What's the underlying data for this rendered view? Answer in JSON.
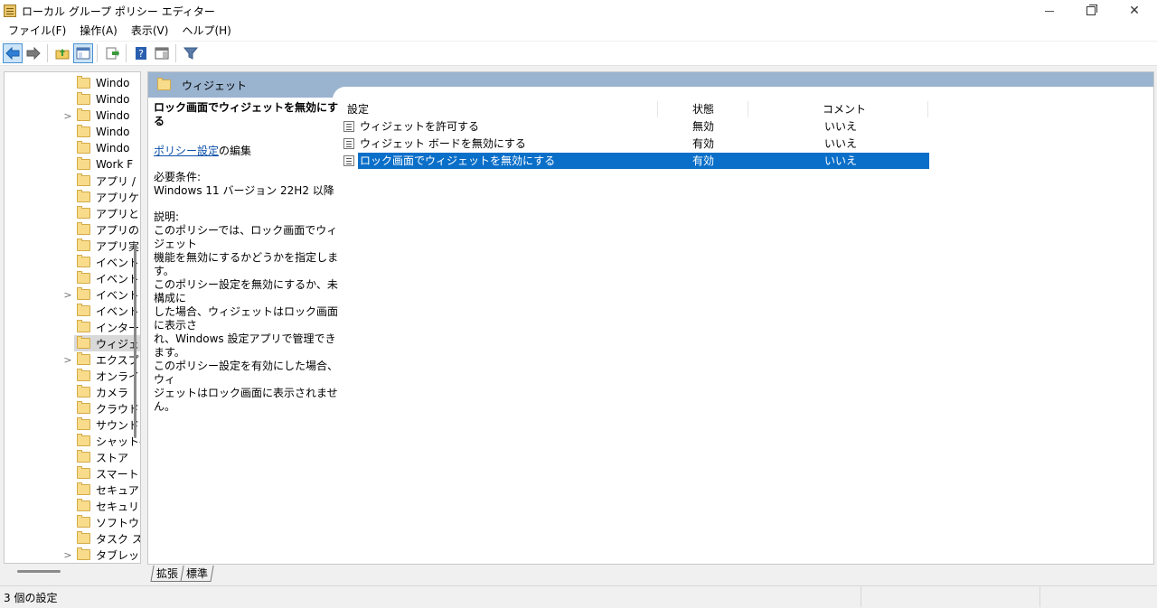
{
  "window": {
    "title": "ローカル グループ ポリシー エディター"
  },
  "menu": [
    "ファイル(F)",
    "操作(A)",
    "表示(V)",
    "ヘルプ(H)"
  ],
  "tree": {
    "items": [
      {
        "label": "Windo",
        "chev": ""
      },
      {
        "label": "Windo",
        "chev": ""
      },
      {
        "label": "Windo",
        "chev": ">"
      },
      {
        "label": "Windo",
        "chev": ""
      },
      {
        "label": "Windo",
        "chev": ""
      },
      {
        "label": "Work F",
        "chev": ""
      },
      {
        "label": "アプリ /",
        "chev": ""
      },
      {
        "label": "アプリケ",
        "chev": ""
      },
      {
        "label": "アプリと",
        "chev": ""
      },
      {
        "label": "アプリの",
        "chev": ""
      },
      {
        "label": "アプリ実",
        "chev": ""
      },
      {
        "label": "イベント",
        "chev": ""
      },
      {
        "label": "イベント",
        "chev": ""
      },
      {
        "label": "イベント",
        "chev": ">"
      },
      {
        "label": "イベント",
        "chev": ""
      },
      {
        "label": "インターこ",
        "chev": ""
      },
      {
        "label": "ウィジェッ",
        "chev": "",
        "selected": true
      },
      {
        "label": "エクスプ",
        "chev": ">"
      },
      {
        "label": "オンライ",
        "chev": ""
      },
      {
        "label": "カメラ",
        "chev": ""
      },
      {
        "label": "クラウド",
        "chev": ""
      },
      {
        "label": "サウンド",
        "chev": ""
      },
      {
        "label": "シャット-",
        "chev": ""
      },
      {
        "label": "ストア",
        "chev": ""
      },
      {
        "label": "スマート",
        "chev": ""
      },
      {
        "label": "セキュア",
        "chev": ""
      },
      {
        "label": "セキュリ",
        "chev": ""
      },
      {
        "label": "ソフトウ:",
        "chev": ""
      },
      {
        "label": "タスク ス",
        "chev": ""
      },
      {
        "label": "タブレッ",
        "chev": ">"
      }
    ]
  },
  "panel": {
    "header": "ウィジェット",
    "description": {
      "title": "ロック画面でウィジェットを無効にする",
      "edit_link": "ポリシー設定",
      "edit_suffix": "の編集",
      "req_label": "必要条件:",
      "req_value": "Windows 11 バージョン 22H2 以降",
      "desc_label": "説明:",
      "desc_lines": [
        "このポリシーでは、ロック画面でウィジェット",
        "機能を無効にするかどうかを指定します。",
        "このポリシー設定を無効にするか、未構成に",
        "した場合、ウィジェットはロック画面に表示さ",
        "れ、Windows 設定アプリで管理できます。",
        "このポリシー設定を有効にした場合、ウィ",
        "ジェットはロック画面に表示されません。"
      ]
    },
    "columns": {
      "setting": "設定",
      "state": "状態",
      "comment": "コメント"
    },
    "rows": [
      {
        "name": "ウィジェットを許可する",
        "state": "無効",
        "comment": "いいえ"
      },
      {
        "name": "ウィジェット ボードを無効にする",
        "state": "有効",
        "comment": "いいえ"
      },
      {
        "name": "ロック画面でウィジェットを無効にする",
        "state": "有効",
        "comment": "いいえ",
        "selected": true
      }
    ]
  },
  "tabs": [
    "拡張",
    "標準"
  ],
  "status": "3 個の設定"
}
